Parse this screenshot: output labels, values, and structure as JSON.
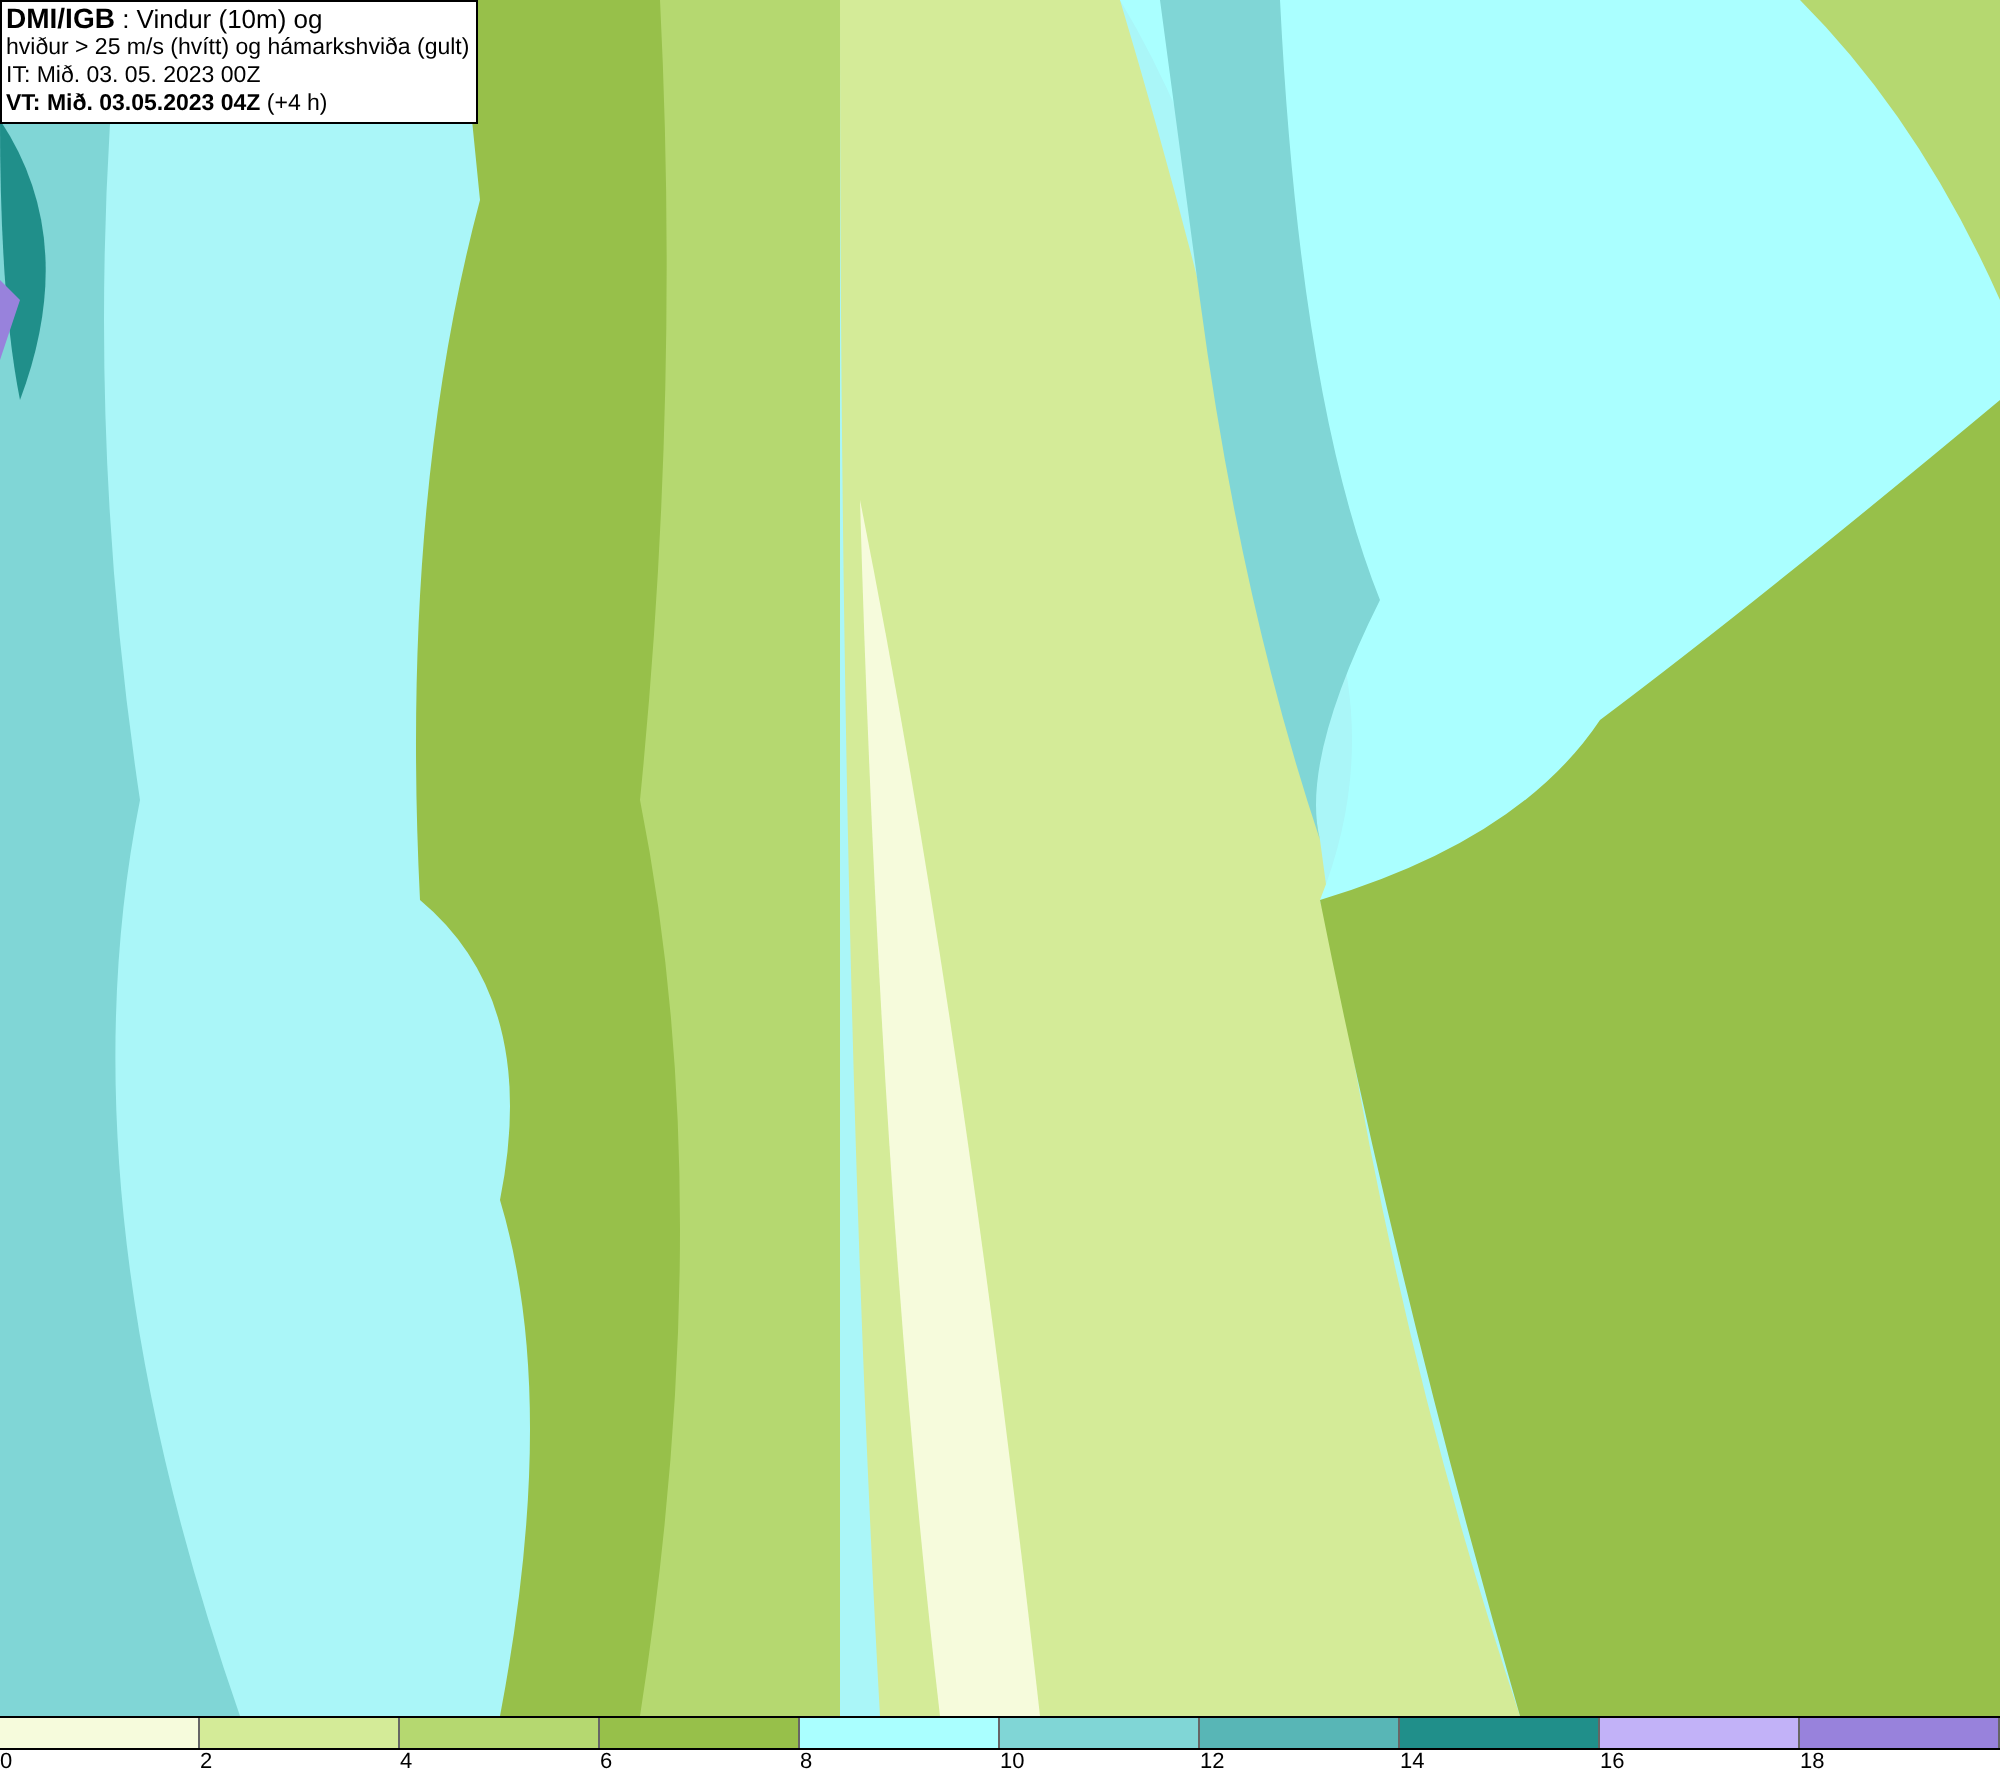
{
  "title_box": {
    "lines": [
      "**DMI/IGB** : Vindur (10m) og",
      "hviður > 25 m/s (hvítt) og hámarkshviða (gult)",
      "IT: Mið. 03. 05. 2023 00Z",
      "**VT: Mið. 03.05.2023 04Z** (+4 h)"
    ]
  },
  "legend": [
    {
      "label": "0",
      "color": "#f6fbdc"
    },
    {
      "label": "2",
      "color": "#d4eb98"
    },
    {
      "label": "4",
      "color": "#b5d870"
    },
    {
      "label": "6",
      "color": "#97c04a"
    },
    {
      "label": "8",
      "color": "#aaffff"
    },
    {
      "label": "10",
      "color": "#80d6d6"
    },
    {
      "label": "12",
      "color": "#58b6b6"
    },
    {
      "label": "14",
      "color": "#208f8a"
    },
    {
      "label": "16",
      "color": "#c2b2f8"
    },
    {
      "label": "18",
      "color": "#9882dc"
    }
  ]
}
